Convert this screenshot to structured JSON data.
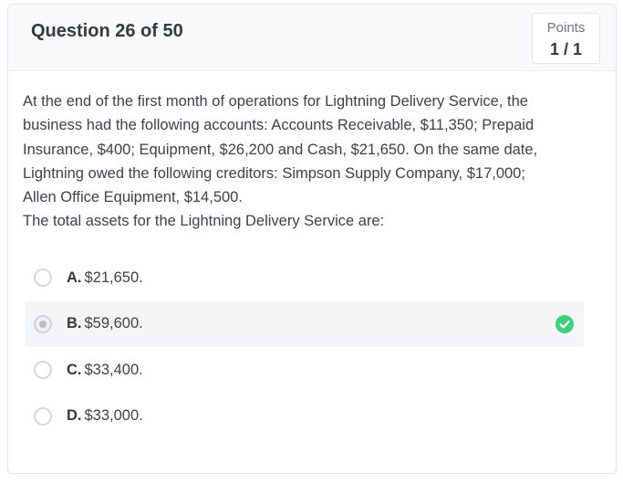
{
  "header": {
    "title": "Question 26 of 50",
    "points_label": "Points",
    "points_value": "1 / 1"
  },
  "question": {
    "lines": [
      "At the end of the first month of operations for Lightning Delivery Service, the",
      "business had the following accounts: Accounts Receivable, $11,350; Prepaid",
      "Insurance, $400; Equipment, $26,200 and Cash, $21,650. On the same date,",
      "Lightning owed the following creditors: Simpson Supply Company, $17,000;",
      "Allen Office Equipment, $14,500.",
      "The total assets for the Lightning Delivery Service are:"
    ]
  },
  "options": [
    {
      "letter": "A.",
      "text": "$21,650.",
      "selected": false
    },
    {
      "letter": "B.",
      "text": "$59,600.",
      "selected": true,
      "correct_icon": "check-circle-icon"
    },
    {
      "letter": "C.",
      "text": "$33,400.",
      "selected": false
    },
    {
      "letter": "D.",
      "text": "$33,000.",
      "selected": false
    }
  ],
  "colors": {
    "correct": "#3ecf7a",
    "header_bg": "#f8f9fa"
  }
}
